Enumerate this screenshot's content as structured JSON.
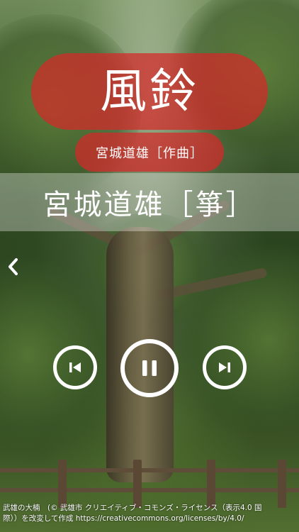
{
  "player": {
    "title": "風鈴",
    "composer": "宮城道雄［作曲］",
    "performer": "宮城道雄［箏］"
  },
  "controls": {
    "back_icon": "chevron-left-icon",
    "prev_icon": "skip-previous-icon",
    "pause_icon": "pause-icon",
    "next_icon": "skip-next-icon",
    "accent_color": "#d62828"
  },
  "credit": {
    "line1": "武雄の大楠　(© 武雄市 クリエイティブ・コモンズ・ライセンス（表示4.0 国",
    "line2": "際））を改変して作成 https://creativecommons.org/licenses/by/4.0/"
  }
}
